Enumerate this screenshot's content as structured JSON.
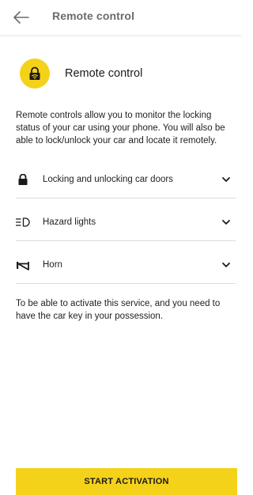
{
  "header": {
    "back_icon": "arrow-left-icon",
    "title": "Remote control"
  },
  "hero": {
    "icon": "lock-wifi-icon",
    "icon_bg_color": "#f4d21a",
    "title": "Remote control"
  },
  "description": "Remote controls allow you to monitor the locking status of your car using your phone. You will also be able to lock/unlock your car and locate it remotely.",
  "features": [
    {
      "icon": "lock-icon",
      "label": "Locking and unlocking car doors",
      "expand_icon": "chevron-down-icon"
    },
    {
      "icon": "hazard-lights-icon",
      "label": "Hazard lights",
      "expand_icon": "chevron-down-icon"
    },
    {
      "icon": "horn-icon",
      "label": "Horn",
      "expand_icon": "chevron-down-icon"
    }
  ],
  "note": "To be able to  activate this service, and you need to have the car key in your possession.",
  "cta": {
    "label": "START ACTIVATION",
    "color": "#f4d21a"
  }
}
